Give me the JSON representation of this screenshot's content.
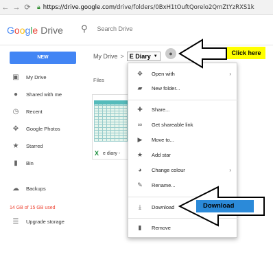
{
  "browser": {
    "url_host": "https://drive.google.com",
    "url_path": "/drive/folders/0BxH1tOuftQorelo2QmZtYzRXS1k"
  },
  "header": {
    "logo_letters": [
      "G",
      "o",
      "o",
      "g",
      "l",
      "e"
    ],
    "product": "Drive",
    "search_placeholder": "Search Drive"
  },
  "toolbar": {
    "new_label": "NEW",
    "breadcrumb_root": "My Drive",
    "breadcrumb_sep": ">",
    "breadcrumb_current": "E Diary"
  },
  "sidebar": {
    "items": [
      {
        "label": "My Drive",
        "icon": "drive-icon"
      },
      {
        "label": "Shared with me",
        "icon": "people-icon"
      },
      {
        "label": "Recent",
        "icon": "clock-icon"
      },
      {
        "label": "Google Photos",
        "icon": "photos-icon"
      },
      {
        "label": "Starred",
        "icon": "star-icon"
      },
      {
        "label": "Bin",
        "icon": "bin-icon"
      },
      {
        "label": "Backups",
        "icon": "cloud-icon"
      }
    ],
    "storage": "14 GB of 15 GB used",
    "upgrade": "Upgrade storage"
  },
  "content": {
    "files_label": "Files",
    "file_name": "e diary -"
  },
  "menu": {
    "items": [
      {
        "label": "Open with",
        "icon": "open-with-icon",
        "submenu": true
      },
      {
        "label": "New folder...",
        "icon": "new-folder-icon",
        "submenu": false
      },
      {
        "label": "Share...",
        "icon": "share-person-icon",
        "submenu": false
      },
      {
        "label": "Get shareable link",
        "icon": "link-icon",
        "submenu": false
      },
      {
        "label": "Move to...",
        "icon": "move-to-icon",
        "submenu": false
      },
      {
        "label": "Add star",
        "icon": "star-icon",
        "submenu": false
      },
      {
        "label": "Change colour",
        "icon": "palette-icon",
        "submenu": true
      },
      {
        "label": "Rename...",
        "icon": "rename-icon",
        "submenu": false
      },
      {
        "label": "Download",
        "icon": "download-icon",
        "submenu": false
      },
      {
        "label": "Remove",
        "icon": "trash-icon",
        "submenu": false
      }
    ]
  },
  "annotations": {
    "click_here": "Click here",
    "download": "Download"
  },
  "colors": {
    "new_button": "#4285f4",
    "storage_warning": "#ee4433",
    "callout_yellow": "#ffff00",
    "callout_blue": "#2b8ad9"
  }
}
